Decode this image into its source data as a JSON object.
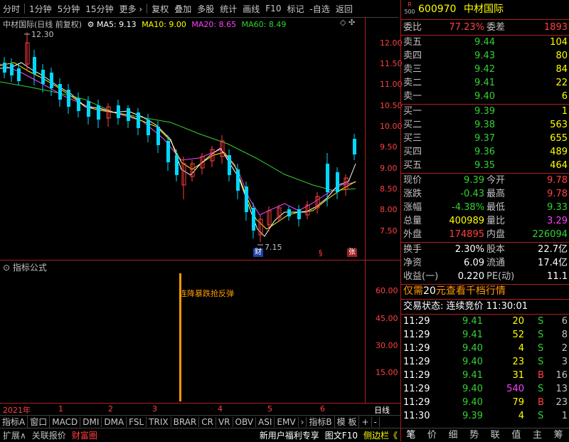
{
  "toolbar": {
    "items": [
      "分时",
      "1分钟",
      "5分钟",
      "15分钟",
      "更多 ›",
      "复权",
      "叠加",
      "多股",
      "统计",
      "画线",
      "F10",
      "标记",
      "-自选",
      "返回"
    ]
  },
  "chart_header": {
    "stock": "中材国际(日线 前复权)",
    "ma5_label": "MA5: 9.13",
    "ma10_label": "MA10: 9.00",
    "ma20_label": "MA20: 8.65",
    "ma60_label": "MA60: 8.49",
    "high_marker": "12.30",
    "low_marker": "7.15",
    "marker_cai": "财",
    "marker_s": "§",
    "marker_zhang": "张"
  },
  "price_axis": [
    "12.00",
    "11.50",
    "11.00",
    "10.50",
    "10.00",
    "9.50",
    "9.00",
    "8.50",
    "8.00",
    "7.50"
  ],
  "indicator": {
    "title": "指标公式",
    "signal_label": "连降暴跌抢反弹",
    "axis": [
      "60.00",
      "45.00",
      "30.00",
      "15.00"
    ]
  },
  "time_axis": {
    "year": "2021年",
    "months": [
      "1",
      "2",
      "3",
      "4",
      "5",
      "6"
    ],
    "period": "日线"
  },
  "tabs": [
    "指标A",
    "窗口",
    "MACD",
    "DMI",
    "DMA",
    "FSL",
    "TRIX",
    "BRAR",
    "CR",
    "VR",
    "OBV",
    "ASI",
    "EMV",
    "›",
    "指标B",
    "模 板",
    "+",
    "-"
  ],
  "bottom_bar": {
    "left": [
      "扩展∧",
      "关联报价",
      "财富圈"
    ],
    "right": [
      "新用户福利专享",
      "图文F10",
      "侧边栏《"
    ]
  },
  "quote": {
    "badge_r": "R",
    "badge_num": "500",
    "code": "600970",
    "name": "中材国际",
    "weibi_label": "委比",
    "weibi": "77.23%",
    "weicha_label": "委差",
    "weicha": "1893",
    "sells": [
      {
        "label": "卖五",
        "price": "9.44",
        "vol": "104"
      },
      {
        "label": "卖四",
        "price": "9.43",
        "vol": "80"
      },
      {
        "label": "卖三",
        "price": "9.42",
        "vol": "84"
      },
      {
        "label": "卖二",
        "price": "9.41",
        "vol": "22"
      },
      {
        "label": "卖一",
        "price": "9.40",
        "vol": "6"
      }
    ],
    "buys": [
      {
        "label": "买一",
        "price": "9.39",
        "vol": "1"
      },
      {
        "label": "买二",
        "price": "9.38",
        "vol": "563"
      },
      {
        "label": "买三",
        "price": "9.37",
        "vol": "655"
      },
      {
        "label": "买四",
        "price": "9.36",
        "vol": "489"
      },
      {
        "label": "买五",
        "price": "9.35",
        "vol": "464"
      }
    ],
    "stats": [
      {
        "l1": "现价",
        "v1": "9.39",
        "l2": "今开",
        "v2": "9.78"
      },
      {
        "l1": "涨跌",
        "v1": "-0.43",
        "l2": "最高",
        "v2": "9.78"
      },
      {
        "l1": "涨幅",
        "v1": "-4.38%",
        "l2": "最低",
        "v2": "9.33"
      },
      {
        "l1": "总量",
        "v1": "400989",
        "l2": "量比",
        "v2": "3.29"
      },
      {
        "l1": "外盘",
        "v1": "174895",
        "l2": "内盘",
        "v2": "226094"
      }
    ],
    "stats2": [
      {
        "l1": "换手",
        "v1": "2.30%",
        "l2": "股本",
        "v2": "22.7亿"
      },
      {
        "l1": "净资",
        "v1": "6.09",
        "l2": "流通",
        "v2": "17.4亿"
      },
      {
        "l1": "收益(一)",
        "v1": "0.220",
        "l2": "PE(动)",
        "v2": "11.1"
      }
    ],
    "promo_a": "仅需",
    "promo_b": "20",
    "promo_c": "元查看千档行情",
    "trade_state": "交易状态: 连续竞价 11:30:01",
    "ticks": [
      {
        "t": "11:29",
        "p": "9.41",
        "v": "20",
        "d": "S",
        "n": "6"
      },
      {
        "t": "11:29",
        "p": "9.41",
        "v": "52",
        "d": "S",
        "n": "8"
      },
      {
        "t": "11:29",
        "p": "9.40",
        "v": "4",
        "d": "S",
        "n": "2"
      },
      {
        "t": "11:29",
        "p": "9.40",
        "v": "23",
        "d": "S",
        "n": "3"
      },
      {
        "t": "11:29",
        "p": "9.41",
        "v": "31",
        "d": "B",
        "n": "16"
      },
      {
        "t": "11:29",
        "p": "9.40",
        "v": "540",
        "d": "S",
        "n": "13"
      },
      {
        "t": "11:29",
        "p": "9.40",
        "v": "79",
        "d": "B",
        "n": "23"
      },
      {
        "t": "11:30",
        "p": "9.39",
        "v": "4",
        "d": "S",
        "n": "1"
      }
    ],
    "tabs": [
      "笔",
      "价",
      "细",
      "势",
      "联",
      "值",
      "主",
      "筹"
    ]
  }
}
